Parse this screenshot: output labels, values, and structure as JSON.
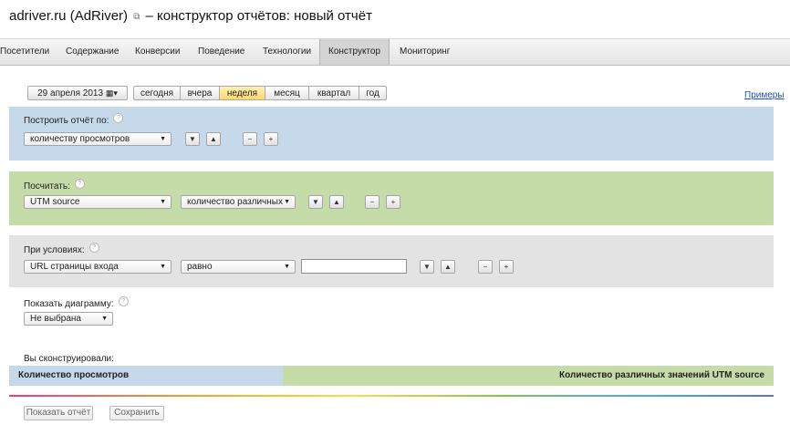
{
  "header": {
    "title": "adriver.ru (AdRiver)",
    "subtitle": "– конструктор отчётов: новый отчёт"
  },
  "nav": {
    "tabs": [
      {
        "label": "Посетители"
      },
      {
        "label": "Содержание"
      },
      {
        "label": "Конверсии"
      },
      {
        "label": "Поведение"
      },
      {
        "label": "Технологии"
      },
      {
        "label": "Конструктор",
        "active": true
      },
      {
        "label": "Мониторинг"
      }
    ]
  },
  "date_bar": {
    "date": "29 апреля 2013",
    "periods": [
      "сегодня",
      "вчера",
      "неделя",
      "месяц",
      "квартал",
      "год"
    ],
    "active_period": "неделя",
    "examples_link": "Примеры"
  },
  "build": {
    "label": "Построить отчёт по:",
    "select_value": "количеству просмотров"
  },
  "count": {
    "label": "Посчитать:",
    "select_value": "UTM source",
    "select2_value": "количество различных"
  },
  "conditions": {
    "label": "При условиях:",
    "select_value": "URL страницы входа",
    "operator_value": "равно",
    "input_value": ""
  },
  "chart": {
    "label": "Показать диаграмму:",
    "select_value": "Не выбрана"
  },
  "result": {
    "label": "Вы сконструировали:",
    "left": "Количество просмотров",
    "right": "Количество различных значений UTM source"
  },
  "footer": {
    "show_button": "Показать отчёт",
    "save_button": "Сохранить"
  },
  "controls": {
    "down": "▼",
    "up": "▲",
    "minus": "−",
    "plus": "+",
    "help": "?"
  },
  "colors": {
    "blue_panel": "#c5d9ea",
    "green_panel": "#c5dba8",
    "gray_panel": "#e3e3e3",
    "active_period": "#ffd769",
    "link": "#1f4fc1"
  }
}
